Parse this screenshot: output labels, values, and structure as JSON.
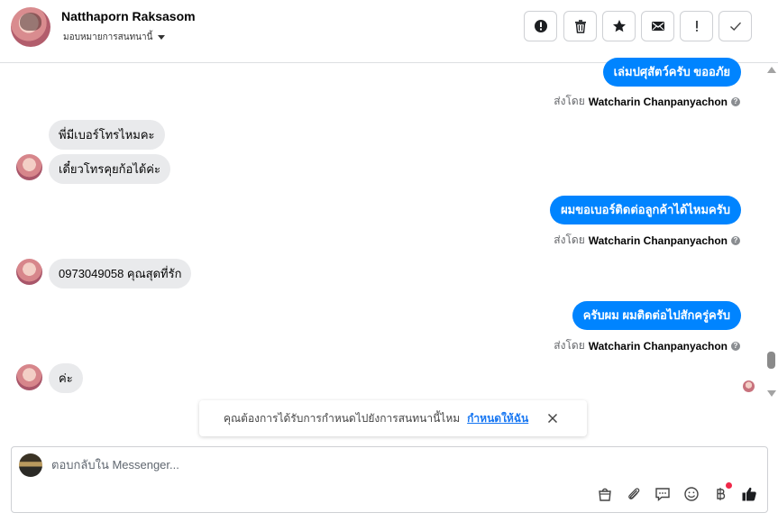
{
  "header": {
    "contact_name": "Natthaporn Raksasom",
    "assign_label": "มอบหมายการสนทนานี้",
    "toolbar": [
      {
        "name": "spam-button",
        "icon": "alert-circle-icon"
      },
      {
        "name": "delete-button",
        "icon": "trash-icon"
      },
      {
        "name": "star-button",
        "icon": "star-icon"
      },
      {
        "name": "mark-unread-button",
        "icon": "envelope-icon"
      },
      {
        "name": "follow-up-button",
        "icon": "exclamation-icon"
      },
      {
        "name": "mark-done-button",
        "icon": "check-icon"
      }
    ]
  },
  "messages": {
    "out1": "เล่มปศุสัตว์ครับ ขออภัย",
    "sent_by_prefix": "ส่งโดย",
    "sender": "Watcharin Chanpanyachon",
    "in1": "พี่มีเบอร์โทรไหมคะ",
    "in2": "เดี๋ยวโทรคุยก้อได้ค่ะ",
    "out2": "ผมขอเบอร์ติดต่อลูกค้าได้ไหมครับ",
    "in3": "0973049058 คุณสุดที่รัก",
    "out3": "ครับผม ผมติดต่อไปสักครู่ครับ",
    "in4": "ค่ะ"
  },
  "notice": {
    "text": "คุณต้องการได้รับการกำหนดไปยังการสนทนานี้ไหม",
    "link": "กำหนดให้ฉัน"
  },
  "composer": {
    "placeholder": "ตอบกลับใน Messenger..."
  },
  "colors": {
    "outgoing_bubble": "#0084ff",
    "incoming_bubble": "#e9eaec",
    "link": "#1877f2",
    "like": "#1c1e21",
    "notification_dot": "#f02849"
  }
}
